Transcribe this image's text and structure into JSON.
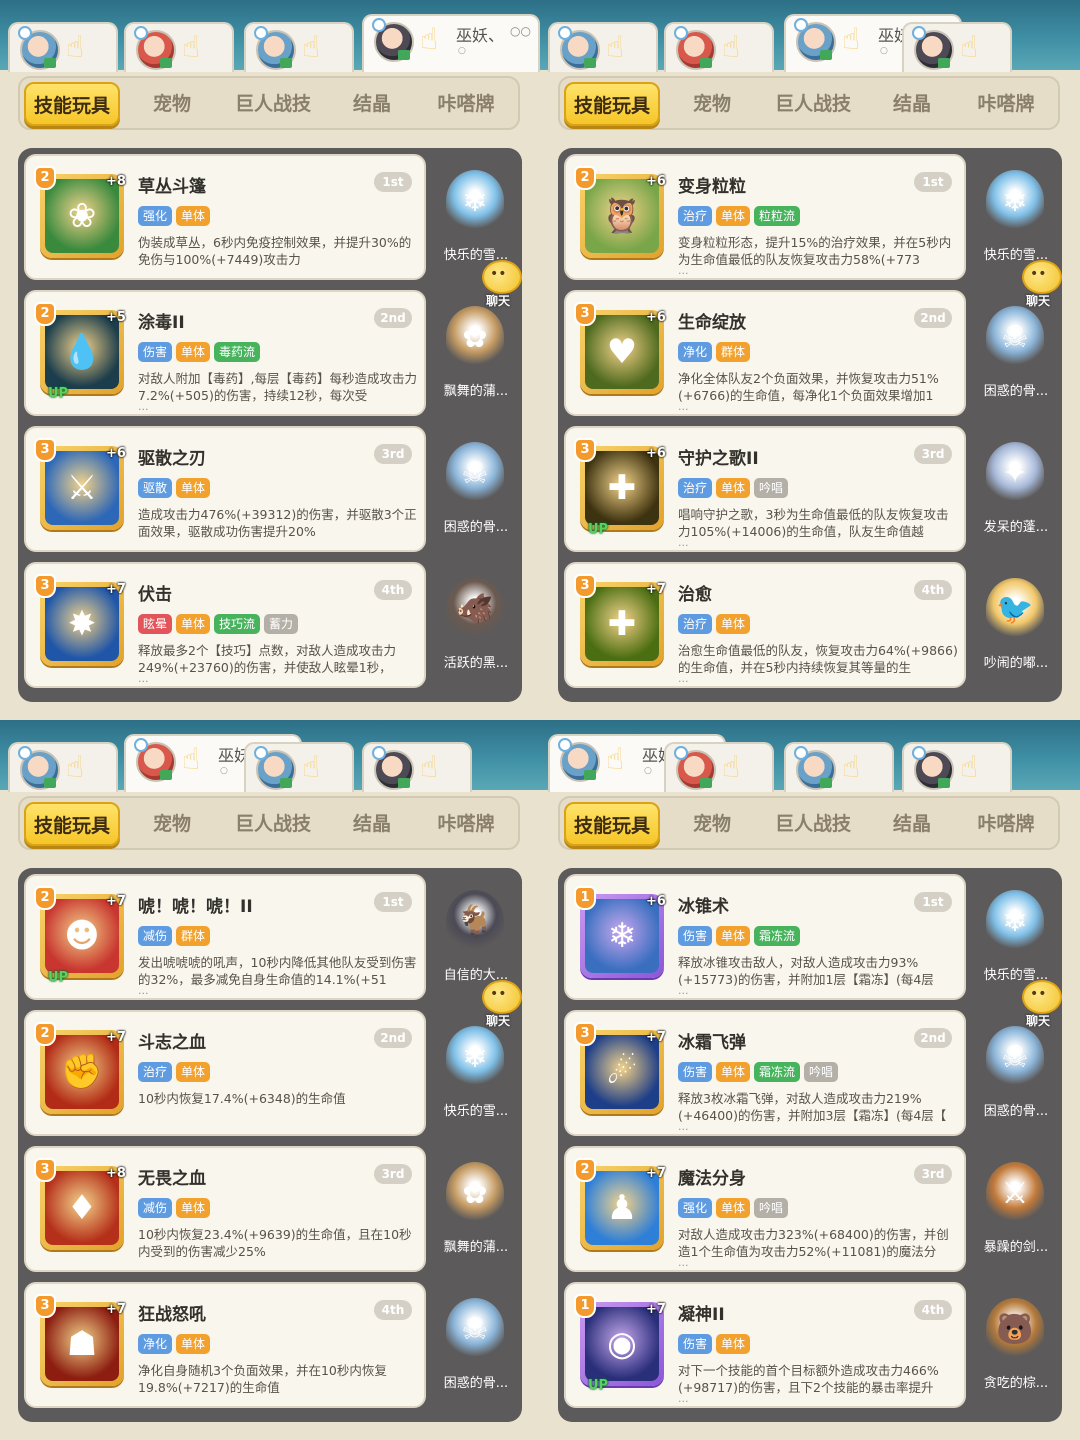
{
  "colors": {
    "tag_green": "#47b35d",
    "tag_blue": "#5f9be0",
    "tag_orange": "#f2a22c",
    "tag_red": "#e2555a",
    "tag_gray": "#b4b0a8"
  },
  "quadrants": [
    {
      "player_tabs": [
        {
          "name": "",
          "dots": "",
          "circle": "",
          "avatar": "blue"
        },
        {
          "name": "",
          "dots": "",
          "circle": "",
          "avatar": "red"
        },
        {
          "name": "",
          "dots": "",
          "circle": "",
          "avatar": "blue"
        },
        {
          "name": "巫妖、",
          "dots": "○○",
          "circle": "○",
          "avatar": "dark"
        }
      ],
      "active_player": 3,
      "nav": [
        "技能玩具",
        "宠物",
        "巨人战技",
        "结晶",
        "咔嗒牌"
      ],
      "chat_label": "聊天",
      "cards": [
        {
          "title": "草丛斗篷",
          "rank": "1st",
          "level": "2",
          "plus": "+8",
          "up": false,
          "icon": "leaf-icon",
          "iconbg": "#3a8a3e",
          "glyph": "❀",
          "frame": "gold",
          "tags": [
            {
              "t": "强化",
              "c": "tag_blue"
            },
            {
              "t": "单体",
              "c": "tag_orange"
            }
          ],
          "desc": "伪装成草丛，6秒内免疫控制效果，并提升30%的免伤与100%(+7449)攻击力",
          "more": "",
          "pet": "快乐的雪...",
          "petbg": "#7fc0e8",
          "petglyph": "❄"
        },
        {
          "title": "涂毒II",
          "rank": "2nd",
          "level": "2",
          "plus": "+5",
          "up": true,
          "icon": "droplet-icon",
          "iconbg": "#1b3d4c",
          "glyph": "💧",
          "frame": "gold",
          "tags": [
            {
              "t": "伤害",
              "c": "tag_blue"
            },
            {
              "t": "单体",
              "c": "tag_orange"
            },
            {
              "t": "毒药流",
              "c": "tag_green"
            }
          ],
          "desc": "对敌人附加【毒药】,每层【毒药】每秒造成攻击力7.2%(+505)的伤害，持续12秒，每次受",
          "more": "...",
          "pet": "飘舞的蒲...",
          "petbg": "#c49a62",
          "petglyph": "✿"
        },
        {
          "title": "驱散之刃",
          "rank": "3rd",
          "level": "3",
          "plus": "+6",
          "up": false,
          "icon": "sword-icon",
          "iconbg": "#2c67b8",
          "glyph": "⚔",
          "frame": "gold",
          "tags": [
            {
              "t": "驱散",
              "c": "tag_blue"
            },
            {
              "t": "单体",
              "c": "tag_orange"
            }
          ],
          "desc": "造成攻击力476%(+39312)的伤害，并驱散3个正面效果，驱散成功伤害提升20%",
          "more": "",
          "pet": "困惑的骨...",
          "petbg": "#8ab4d8",
          "petglyph": "☠"
        },
        {
          "title": "伏击",
          "rank": "4th",
          "level": "3",
          "plus": "+7",
          "up": false,
          "icon": "ambush-icon",
          "iconbg": "#1f56a8",
          "glyph": "✸",
          "frame": "gold",
          "tags": [
            {
              "t": "眩晕",
              "c": "tag_red"
            },
            {
              "t": "单体",
              "c": "tag_orange"
            },
            {
              "t": "技巧流",
              "c": "tag_green"
            },
            {
              "t": "蓄力",
              "c": "tag_gray"
            }
          ],
          "desc": "释放最多2个【技巧】点数，对敌人造成攻击力249%(+23760)的伤害，并使敌人眩晕1秒，",
          "more": "...",
          "pet": "活跃的黑...",
          "petbg": "#6b5a50",
          "petglyph": "🐗"
        }
      ]
    },
    {
      "player_tabs": [
        {
          "name": "",
          "dots": "",
          "circle": "",
          "avatar": "blue"
        },
        {
          "name": "",
          "dots": "",
          "circle": "",
          "avatar": "red"
        },
        {
          "name": "巫妖、",
          "dots": "○○",
          "circle": "○",
          "avatar": "blue"
        },
        {
          "name": "",
          "dots": "",
          "circle": "",
          "avatar": "dark"
        }
      ],
      "active_player": 2,
      "nav": [
        "技能玩具",
        "宠物",
        "巨人战技",
        "结晶",
        "咔嗒牌"
      ],
      "chat_label": "聊天",
      "cards": [
        {
          "title": "变身粒粒",
          "rank": "1st",
          "level": "2",
          "plus": "+6",
          "up": false,
          "icon": "owl-icon",
          "iconbg": "#7aa64a",
          "glyph": "🦉",
          "frame": "gold",
          "tags": [
            {
              "t": "治疗",
              "c": "tag_blue"
            },
            {
              "t": "单体",
              "c": "tag_orange"
            },
            {
              "t": "粒粒流",
              "c": "tag_green"
            }
          ],
          "desc": "变身粒粒形态，提升15%的治疗效果，并在5秒内为生命值最低的队友恢复攻击力58%(+773",
          "more": "...",
          "pet": "快乐的雪...",
          "petbg": "#7fc0e8",
          "petglyph": "❄"
        },
        {
          "title": "生命绽放",
          "rank": "2nd",
          "level": "3",
          "plus": "+6",
          "up": false,
          "icon": "heart-icon",
          "iconbg": "#4e6a1e",
          "glyph": "♥",
          "frame": "gold",
          "tags": [
            {
              "t": "净化",
              "c": "tag_blue"
            },
            {
              "t": "群体",
              "c": "tag_orange"
            }
          ],
          "desc": "净化全体队友2个负面效果，并恢复攻击力51%(+6766)的生命值，每净化1个负面效果增加1",
          "more": "...",
          "pet": "困惑的骨...",
          "petbg": "#8ab4d8",
          "petglyph": "☠"
        },
        {
          "title": "守护之歌II",
          "rank": "3rd",
          "level": "3",
          "plus": "+6",
          "up": true,
          "icon": "shield-cross-icon",
          "iconbg": "#3e3310",
          "glyph": "✚",
          "frame": "gold",
          "tags": [
            {
              "t": "治疗",
              "c": "tag_blue"
            },
            {
              "t": "单体",
              "c": "tag_orange"
            },
            {
              "t": "吟唱",
              "c": "tag_gray"
            }
          ],
          "desc": "唱响守护之歌，3秒为生命值最低的队友恢复攻击力105%(+14006)的生命值，队友生命值越",
          "more": "...",
          "pet": "发呆的蓬...",
          "petbg": "#a7b9d9",
          "petglyph": "✦"
        },
        {
          "title": "治愈",
          "rank": "4th",
          "level": "3",
          "plus": "+7",
          "up": false,
          "icon": "heal-icon",
          "iconbg": "#4b6e12",
          "glyph": "✚",
          "frame": "gold",
          "tags": [
            {
              "t": "治疗",
              "c": "tag_blue"
            },
            {
              "t": "单体",
              "c": "tag_orange"
            }
          ],
          "desc": "治愈生命值最低的队友，恢复攻击力64%(+9866)的生命值，并在5秒内持续恢复其等量的生",
          "more": "...",
          "pet": "吵闹的嘟...",
          "petbg": "#f2c86a",
          "petglyph": "🐦"
        }
      ]
    },
    {
      "player_tabs": [
        {
          "name": "",
          "dots": "",
          "circle": "",
          "avatar": "blue"
        },
        {
          "name": "巫妖、",
          "dots": "○○",
          "circle": "○",
          "avatar": "red"
        },
        {
          "name": "",
          "dots": "",
          "circle": "",
          "avatar": "blue"
        },
        {
          "name": "",
          "dots": "",
          "circle": "",
          "avatar": "dark"
        }
      ],
      "active_player": 1,
      "nav": [
        "技能玩具",
        "宠物",
        "巨人战技",
        "结晶",
        "咔嗒牌"
      ],
      "chat_label": "聊天",
      "cards": [
        {
          "title": "唬！唬！唬！II",
          "rank": "1st",
          "level": "2",
          "plus": "+7",
          "up": true,
          "icon": "roar-icon",
          "iconbg": "#c8362f",
          "glyph": "☻",
          "frame": "gold",
          "tags": [
            {
              "t": "减伤",
              "c": "tag_blue"
            },
            {
              "t": "群体",
              "c": "tag_orange"
            }
          ],
          "desc": "发出唬唬唬的吼声，10秒内降低其他队友受到伤害的32%，最多减免自身生命值的14.1%(+51",
          "more": "...",
          "pet": "自信的大...",
          "petbg": "#4b4a55",
          "petglyph": "🐐"
        },
        {
          "title": "斗志之血",
          "rank": "2nd",
          "level": "2",
          "plus": "+7",
          "up": false,
          "icon": "fist-icon",
          "iconbg": "#b22b16",
          "glyph": "✊",
          "frame": "gold",
          "tags": [
            {
              "t": "治疗",
              "c": "tag_blue"
            },
            {
              "t": "单体",
              "c": "tag_orange"
            }
          ],
          "desc": "10秒内恢复17.4%(+6348)的生命值",
          "more": "",
          "pet": "快乐的雪...",
          "petbg": "#7fc0e8",
          "petglyph": "❄"
        },
        {
          "title": "无畏之血",
          "rank": "3rd",
          "level": "3",
          "plus": "+8",
          "up": false,
          "icon": "blood-drop-icon",
          "iconbg": "#b5301a",
          "glyph": "♦",
          "frame": "gold",
          "tags": [
            {
              "t": "减伤",
              "c": "tag_blue"
            },
            {
              "t": "单体",
              "c": "tag_orange"
            }
          ],
          "desc": "10秒内恢复23.4%(+9639)的生命值，且在10秒内受到的伤害减少25%",
          "more": "",
          "pet": "飘舞的蒲...",
          "petbg": "#c49a62",
          "petglyph": "✿"
        },
        {
          "title": "狂战怒吼",
          "rank": "4th",
          "level": "3",
          "plus": "+7",
          "up": false,
          "icon": "berserk-icon",
          "iconbg": "#8c1d10",
          "glyph": "☗",
          "frame": "gold",
          "tags": [
            {
              "t": "净化",
              "c": "tag_blue"
            },
            {
              "t": "单体",
              "c": "tag_orange"
            }
          ],
          "desc": "净化自身随机3个负面效果，并在10秒内恢复19.8%(+7217)的生命值",
          "more": "",
          "pet": "困惑的骨...",
          "petbg": "#8ab4d8",
          "petglyph": "☠"
        }
      ]
    },
    {
      "player_tabs": [
        {
          "name": "巫妖、",
          "dots": "○○",
          "circle": "○",
          "avatar": "blue"
        },
        {
          "name": "",
          "dots": "",
          "circle": "",
          "avatar": "red"
        },
        {
          "name": "",
          "dots": "",
          "circle": "",
          "avatar": "blue"
        },
        {
          "name": "",
          "dots": "",
          "circle": "",
          "avatar": "dark"
        }
      ],
      "active_player": 0,
      "nav": [
        "技能玩具",
        "宠物",
        "巨人战技",
        "结晶",
        "咔嗒牌"
      ],
      "chat_label": "聊天",
      "cards": [
        {
          "title": "冰锥术",
          "rank": "1st",
          "level": "1",
          "plus": "+6",
          "up": false,
          "icon": "ice-shard-icon",
          "iconbg": "#3a6fc0",
          "glyph": "❄",
          "frame": "purple",
          "tags": [
            {
              "t": "伤害",
              "c": "tag_blue"
            },
            {
              "t": "单体",
              "c": "tag_orange"
            },
            {
              "t": "霜冻流",
              "c": "tag_green"
            }
          ],
          "desc": "释放冰锥攻击敌人，对敌人造成攻击力93%(+15773)的伤害，并附加1层【霜冻】(每4层【霜",
          "more": "...",
          "pet": "快乐的雪...",
          "petbg": "#7fc0e8",
          "petglyph": "❄"
        },
        {
          "title": "冰霜飞弹",
          "rank": "2nd",
          "level": "3",
          "plus": "+7",
          "up": false,
          "icon": "frost-missile-icon",
          "iconbg": "#1d3e88",
          "glyph": "☄",
          "frame": "gold",
          "tags": [
            {
              "t": "伤害",
              "c": "tag_blue"
            },
            {
              "t": "单体",
              "c": "tag_orange"
            },
            {
              "t": "霜冻流",
              "c": "tag_green"
            },
            {
              "t": "吟唱",
              "c": "tag_gray"
            }
          ],
          "desc": "释放3枚冰霜飞弹，对敌人造成攻击力219%(+46400)的伤害，并附加3层【霜冻】(每4层【",
          "more": "...",
          "pet": "困惑的骨...",
          "petbg": "#8ab4d8",
          "petglyph": "☠"
        },
        {
          "title": "魔法分身",
          "rank": "3rd",
          "level": "2",
          "plus": "+7",
          "up": false,
          "icon": "clone-icon",
          "iconbg": "#2e7fd8",
          "glyph": "♟",
          "frame": "gold",
          "tags": [
            {
              "t": "强化",
              "c": "tag_blue"
            },
            {
              "t": "单体",
              "c": "tag_orange"
            },
            {
              "t": "吟唱",
              "c": "tag_gray"
            }
          ],
          "desc": "对敌人造成攻击力323%(+68400)的伤害，并创造1个生命值为攻击力52%(+11081)的魔法分",
          "more": "...",
          "pet": "暴躁的剑...",
          "petbg": "#c27a3a",
          "petglyph": "⚔"
        },
        {
          "title": "凝神II",
          "rank": "4th",
          "level": "1",
          "plus": "+7",
          "up": true,
          "icon": "eye-icon",
          "iconbg": "#2a2f7a",
          "glyph": "◉",
          "frame": "purple",
          "tags": [
            {
              "t": "伤害",
              "c": "tag_blue"
            },
            {
              "t": "单体",
              "c": "tag_orange"
            }
          ],
          "desc": "对下一个技能的首个目标额外造成攻击力466%(+98717)的伤害，且下2个技能的暴击率提升",
          "more": "...",
          "pet": "贪吃的棕...",
          "petbg": "#b57a3a",
          "petglyph": "🐻"
        }
      ]
    }
  ]
}
